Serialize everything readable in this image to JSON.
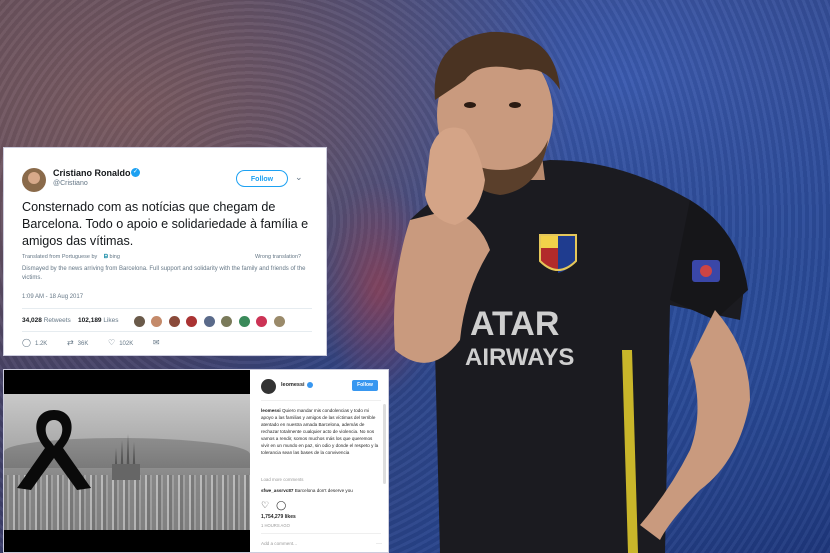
{
  "tweet": {
    "name": "Cristiano Ronaldo",
    "handle": "@Cristiano",
    "follow_label": "Follow",
    "text": "Consternado com as notícias que chegam de Barcelona. Todo o apoio e solidariedade à família e amigos das vítimas.",
    "translated_from": "Translated from Portuguese by",
    "translator": "bing",
    "wrong_translation": "Wrong translation?",
    "translation": "Dismayed by the news arriving from Barcelona. Full support and solidarity with the family and friends of the victims.",
    "time": "1:09 AM - 18 Aug 2017",
    "retweets_count": "34,028",
    "retweets_label": "Retweets",
    "likes_count": "102,189",
    "likes_label": "Likes",
    "reply_count": "1.2K",
    "retweet_count_short": "36K",
    "like_count_short": "102K",
    "colors": {
      "verified": "#1da1f2",
      "accent": "#1da1f2"
    }
  },
  "instagram": {
    "username": "leomessi",
    "follow_label": "Follow",
    "caption_user": "leomessi",
    "caption": "Quiero mandar mis condolencias y todo mi apoyo a las familias y amigos de las víctimas del terrible atentado en nuestra amada Barcelona, además de rechazar totalmente cualquier acto de violencia. No nos vamos a rendir, somos muchos más los que queremos vivir en un mundo en paz, sin odio y donde el respeto y la tolerancia sean las bases de la convivencia",
    "load_more": "Load more comments",
    "comment_user": "sfwe_assrvc87",
    "comment_text": "Barcelona don't deserve you",
    "likes": "1,754,279 likes",
    "ago": "1 HOURS AGO",
    "add_comment": "Add a comment...",
    "colors": {
      "follow": "#3897f0"
    }
  }
}
